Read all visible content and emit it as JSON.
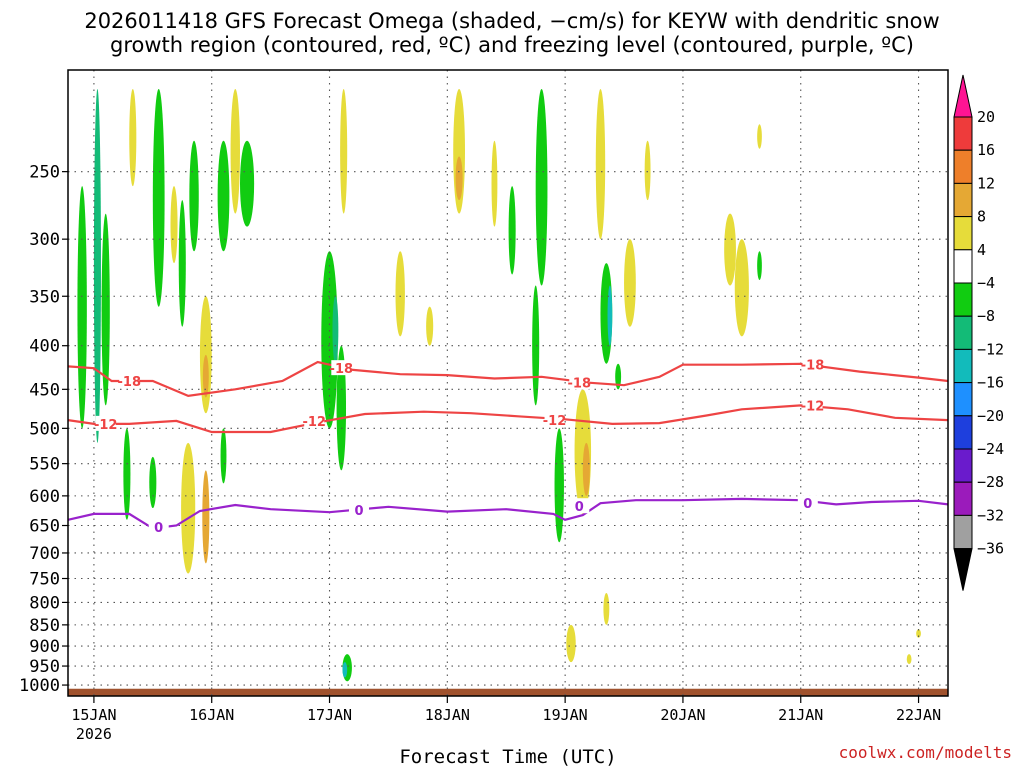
{
  "title": {
    "line1": "2026011418 GFS Forecast Omega (shaded, −cm/s) for KEYW with dendritic snow",
    "line2": "growth region (contoured, red, ºC) and freezing level (contoured, purple, ºC)"
  },
  "credit": "coolwx.com/modelts",
  "colors": {
    "credit": "#cc2222",
    "snow_growth_contour": "#ee4444",
    "freezing_contour": "#9922cc",
    "terrain": "#a0522d"
  },
  "chart_data": {
    "type": "heatmap",
    "xlabel": "Forecast Time (UTC)",
    "ylabel": "",
    "y_scale": "pressure (reversed)",
    "ylim": [
      1030,
      190
    ],
    "y_ticks": [
      250,
      300,
      350,
      400,
      450,
      500,
      550,
      600,
      650,
      700,
      750,
      800,
      850,
      900,
      950,
      1000
    ],
    "x_ticks": [
      {
        "label": "15JAN",
        "sub": "2026",
        "day": 0
      },
      {
        "label": "16JAN",
        "day": 1
      },
      {
        "label": "17JAN",
        "day": 2
      },
      {
        "label": "18JAN",
        "day": 3
      },
      {
        "label": "19JAN",
        "day": 4
      },
      {
        "label": "20JAN",
        "day": 5
      },
      {
        "label": "21JAN",
        "day": 6
      },
      {
        "label": "22JAN",
        "day": 7
      }
    ],
    "xlim_days": [
      -0.22,
      7.25
    ],
    "grid": true,
    "colorbar": {
      "labels": [
        "20",
        "16",
        "12",
        "8",
        "4",
        "−4",
        "−8",
        "−12",
        "−16",
        "−20",
        "−24",
        "−28",
        "−32",
        "−36"
      ],
      "bins": [
        {
          "lo": 20,
          "hi": 99,
          "color": "#ff1493"
        },
        {
          "lo": 16,
          "hi": 20,
          "color": "#ee3b3b"
        },
        {
          "lo": 12,
          "hi": 16,
          "color": "#ee7f2a"
        },
        {
          "lo": 8,
          "hi": 12,
          "color": "#e5a834"
        },
        {
          "lo": 4,
          "hi": 8,
          "color": "#e6dc3a"
        },
        {
          "lo": -4,
          "hi": 4,
          "color": "#ffffff"
        },
        {
          "lo": -8,
          "hi": -4,
          "color": "#11cc11"
        },
        {
          "lo": -12,
          "hi": -8,
          "color": "#13bb77"
        },
        {
          "lo": -16,
          "hi": -12,
          "color": "#12bbbb"
        },
        {
          "lo": -20,
          "hi": -16,
          "color": "#1e90ff"
        },
        {
          "lo": -24,
          "hi": -20,
          "color": "#1e3fdd"
        },
        {
          "lo": -28,
          "hi": -24,
          "color": "#6a1bcc"
        },
        {
          "lo": -32,
          "hi": -28,
          "color": "#9b1bbb"
        },
        {
          "lo": -36,
          "hi": -32,
          "color": "#a0a0a0"
        },
        {
          "lo": -99,
          "hi": -36,
          "color": "#000000"
        }
      ]
    },
    "omega_cells": [
      {
        "day": -0.1,
        "p_top": 260,
        "p_bot": 500,
        "width_days": 0.08,
        "value": -6
      },
      {
        "day": 0.03,
        "p_top": 200,
        "p_bot": 520,
        "width_days": 0.06,
        "value": -10
      },
      {
        "day": 0.1,
        "p_top": 280,
        "p_bot": 470,
        "width_days": 0.07,
        "value": -6
      },
      {
        "day": 0.33,
        "p_top": 200,
        "p_bot": 260,
        "width_days": 0.06,
        "value": 5
      },
      {
        "day": 0.55,
        "p_top": 200,
        "p_bot": 360,
        "width_days": 0.1,
        "value": -6
      },
      {
        "day": 0.68,
        "p_top": 260,
        "p_bot": 320,
        "width_days": 0.06,
        "value": 5
      },
      {
        "day": 0.75,
        "p_top": 270,
        "p_bot": 380,
        "width_days": 0.06,
        "value": -6
      },
      {
        "day": 0.85,
        "p_top": 230,
        "p_bot": 310,
        "width_days": 0.08,
        "value": -7
      },
      {
        "day": 0.95,
        "p_top": 350,
        "p_bot": 480,
        "width_days": 0.1,
        "value": 5
      },
      {
        "day": 0.95,
        "p_top": 410,
        "p_bot": 460,
        "width_days": 0.05,
        "value": 9
      },
      {
        "day": 1.1,
        "p_top": 230,
        "p_bot": 310,
        "width_days": 0.1,
        "value": -7
      },
      {
        "day": 1.2,
        "p_top": 200,
        "p_bot": 280,
        "width_days": 0.08,
        "value": 5
      },
      {
        "day": 1.3,
        "p_top": 230,
        "p_bot": 290,
        "width_days": 0.12,
        "value": -7
      },
      {
        "day": 0.8,
        "p_top": 520,
        "p_bot": 740,
        "width_days": 0.12,
        "value": 5
      },
      {
        "day": 0.95,
        "p_top": 560,
        "p_bot": 720,
        "width_days": 0.06,
        "value": 9
      },
      {
        "day": 0.5,
        "p_top": 540,
        "p_bot": 620,
        "width_days": 0.06,
        "value": -6
      },
      {
        "day": 1.1,
        "p_top": 500,
        "p_bot": 580,
        "width_days": 0.05,
        "value": -6
      },
      {
        "day": 0.28,
        "p_top": 500,
        "p_bot": 640,
        "width_days": 0.06,
        "value": -6
      },
      {
        "day": 2.0,
        "p_top": 310,
        "p_bot": 500,
        "width_days": 0.14,
        "value": -7
      },
      {
        "day": 2.05,
        "p_top": 350,
        "p_bot": 420,
        "width_days": 0.05,
        "value": -10
      },
      {
        "day": 2.12,
        "p_top": 200,
        "p_bot": 280,
        "width_days": 0.06,
        "value": 5
      },
      {
        "day": 2.1,
        "p_top": 400,
        "p_bot": 560,
        "width_days": 0.08,
        "value": -7
      },
      {
        "day": 2.15,
        "p_top": 920,
        "p_bot": 990,
        "width_days": 0.08,
        "value": -8
      },
      {
        "day": 2.13,
        "p_top": 940,
        "p_bot": 980,
        "width_days": 0.04,
        "value": -14
      },
      {
        "day": 2.6,
        "p_top": 310,
        "p_bot": 390,
        "width_days": 0.08,
        "value": 5
      },
      {
        "day": 2.85,
        "p_top": 360,
        "p_bot": 400,
        "width_days": 0.06,
        "value": 5
      },
      {
        "day": 3.1,
        "p_top": 200,
        "p_bot": 280,
        "width_days": 0.1,
        "value": 5
      },
      {
        "day": 3.1,
        "p_top": 240,
        "p_bot": 270,
        "width_days": 0.06,
        "value": 9
      },
      {
        "day": 3.4,
        "p_top": 230,
        "p_bot": 290,
        "width_days": 0.05,
        "value": 5
      },
      {
        "day": 3.55,
        "p_top": 260,
        "p_bot": 330,
        "width_days": 0.06,
        "value": -6
      },
      {
        "day": 3.8,
        "p_top": 200,
        "p_bot": 340,
        "width_days": 0.1,
        "value": -7
      },
      {
        "day": 3.75,
        "p_top": 340,
        "p_bot": 470,
        "width_days": 0.06,
        "value": -6
      },
      {
        "day": 3.95,
        "p_top": 500,
        "p_bot": 680,
        "width_days": 0.08,
        "value": -7
      },
      {
        "day": 4.15,
        "p_top": 450,
        "p_bot": 630,
        "width_days": 0.14,
        "value": 5
      },
      {
        "day": 4.18,
        "p_top": 520,
        "p_bot": 600,
        "width_days": 0.06,
        "value": 9
      },
      {
        "day": 4.3,
        "p_top": 200,
        "p_bot": 300,
        "width_days": 0.08,
        "value": 5
      },
      {
        "day": 4.35,
        "p_top": 320,
        "p_bot": 420,
        "width_days": 0.1,
        "value": -7
      },
      {
        "day": 4.38,
        "p_top": 340,
        "p_bot": 400,
        "width_days": 0.04,
        "value": -14
      },
      {
        "day": 4.45,
        "p_top": 420,
        "p_bot": 450,
        "width_days": 0.05,
        "value": -6
      },
      {
        "day": 4.55,
        "p_top": 300,
        "p_bot": 380,
        "width_days": 0.1,
        "value": 5
      },
      {
        "day": 4.7,
        "p_top": 230,
        "p_bot": 270,
        "width_days": 0.05,
        "value": 5
      },
      {
        "day": 4.05,
        "p_top": 850,
        "p_bot": 940,
        "width_days": 0.08,
        "value": 5
      },
      {
        "day": 4.35,
        "p_top": 780,
        "p_bot": 850,
        "width_days": 0.05,
        "value": 5
      },
      {
        "day": 5.4,
        "p_top": 280,
        "p_bot": 340,
        "width_days": 0.1,
        "value": 5
      },
      {
        "day": 5.5,
        "p_top": 300,
        "p_bot": 390,
        "width_days": 0.12,
        "value": 5
      },
      {
        "day": 5.65,
        "p_top": 310,
        "p_bot": 335,
        "width_days": 0.04,
        "value": -7
      },
      {
        "day": 5.65,
        "p_top": 220,
        "p_bot": 235,
        "width_days": 0.04,
        "value": 5
      },
      {
        "day": 7.0,
        "p_top": 860,
        "p_bot": 880,
        "width_days": 0.04,
        "value": 5
      },
      {
        "day": 6.92,
        "p_top": 920,
        "p_bot": 945,
        "width_days": 0.04,
        "value": 5
      }
    ],
    "contours": [
      {
        "kind": "snow_growth",
        "level": "-18",
        "points": [
          [
            -0.22,
            423
          ],
          [
            0.0,
            425
          ],
          [
            0.15,
            440
          ],
          [
            0.5,
            440
          ],
          [
            0.8,
            458
          ],
          [
            1.2,
            450
          ],
          [
            1.6,
            440
          ],
          [
            1.9,
            418
          ],
          [
            2.2,
            427
          ],
          [
            2.6,
            432
          ],
          [
            3.0,
            433
          ],
          [
            3.4,
            437
          ],
          [
            3.8,
            435
          ],
          [
            4.2,
            442
          ],
          [
            4.5,
            445
          ],
          [
            4.8,
            435
          ],
          [
            5.0,
            421
          ],
          [
            5.5,
            421
          ],
          [
            6.0,
            420
          ],
          [
            6.5,
            429
          ],
          [
            7.0,
            436
          ],
          [
            7.25,
            440
          ]
        ],
        "labels": [
          {
            "day": 0.3,
            "p": 440
          },
          {
            "day": 2.1,
            "p": 425
          },
          {
            "day": 4.12,
            "p": 442
          },
          {
            "day": 6.1,
            "p": 421
          }
        ]
      },
      {
        "kind": "snow_growth",
        "level": "-12",
        "points": [
          [
            -0.22,
            489
          ],
          [
            0.0,
            494
          ],
          [
            0.3,
            494
          ],
          [
            0.7,
            490
          ],
          [
            1.0,
            505
          ],
          [
            1.5,
            505
          ],
          [
            1.9,
            492
          ],
          [
            2.3,
            481
          ],
          [
            2.8,
            478
          ],
          [
            3.2,
            480
          ],
          [
            3.6,
            484
          ],
          [
            4.0,
            488
          ],
          [
            4.4,
            494
          ],
          [
            4.8,
            493
          ],
          [
            5.2,
            483
          ],
          [
            5.5,
            475
          ],
          [
            6.0,
            470
          ],
          [
            6.4,
            475
          ],
          [
            6.8,
            486
          ],
          [
            7.25,
            489
          ]
        ],
        "labels": [
          {
            "day": 0.1,
            "p": 494
          },
          {
            "day": 1.87,
            "p": 490
          },
          {
            "day": 3.91,
            "p": 489
          },
          {
            "day": 6.1,
            "p": 470
          }
        ]
      },
      {
        "kind": "freezing",
        "level": "0",
        "points": [
          [
            -0.22,
            640
          ],
          [
            0.0,
            630
          ],
          [
            0.3,
            630
          ],
          [
            0.5,
            655
          ],
          [
            0.7,
            650
          ],
          [
            0.9,
            625
          ],
          [
            1.2,
            615
          ],
          [
            1.5,
            622
          ],
          [
            2.0,
            627
          ],
          [
            2.5,
            618
          ],
          [
            3.0,
            626
          ],
          [
            3.5,
            622
          ],
          [
            3.9,
            630
          ],
          [
            4.0,
            640
          ],
          [
            4.15,
            632
          ],
          [
            4.3,
            612
          ],
          [
            4.6,
            607
          ],
          [
            5.0,
            607
          ],
          [
            5.5,
            605
          ],
          [
            6.0,
            607
          ],
          [
            6.3,
            614
          ],
          [
            6.6,
            610
          ],
          [
            7.0,
            608
          ],
          [
            7.25,
            614
          ]
        ],
        "labels": [
          {
            "day": 0.55,
            "p": 653
          },
          {
            "day": 2.25,
            "p": 623
          },
          {
            "day": 4.12,
            "p": 617
          },
          {
            "day": 6.06,
            "p": 612
          }
        ]
      }
    ],
    "terrain": {
      "p_top": 1010,
      "p_bot": 1030
    }
  }
}
